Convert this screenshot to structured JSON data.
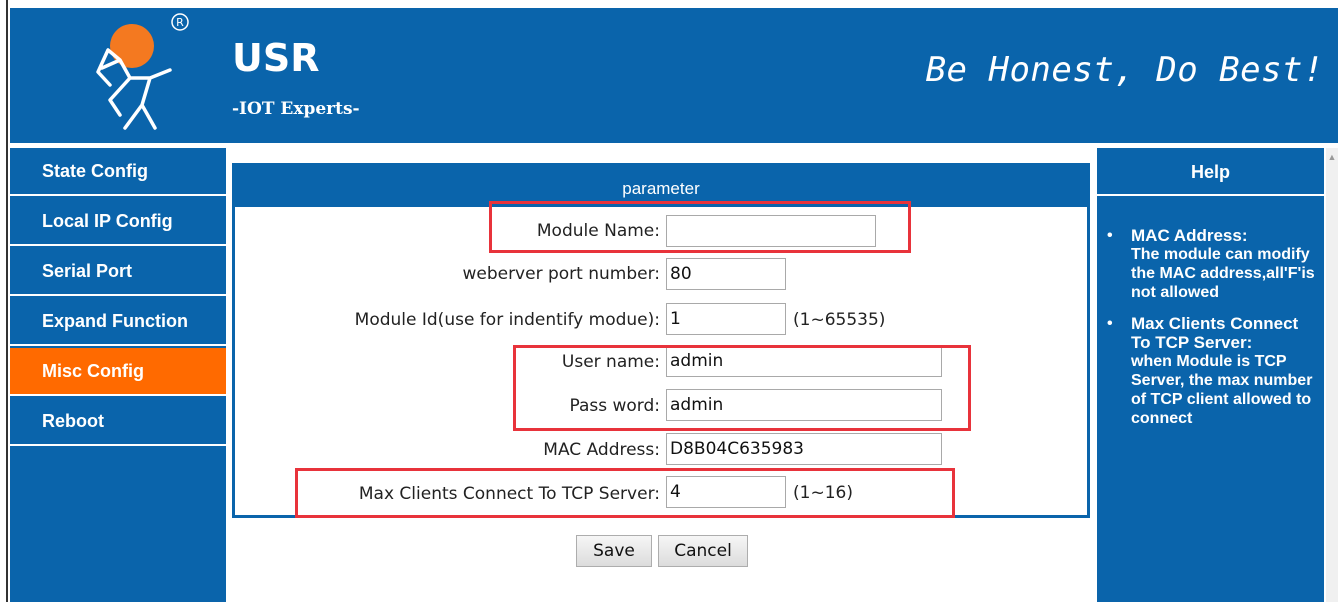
{
  "header": {
    "brand": "USR",
    "tagline": "-IOT Experts-",
    "motto": "Be Honest, Do Best!",
    "colors": {
      "brand_blue": "#0a64ab",
      "logo_orange": "#f47920",
      "accent_orange": "#ff6a00",
      "highlight_red": "#e8333b"
    }
  },
  "sidebar": {
    "items": [
      {
        "label": "State Config",
        "active": false
      },
      {
        "label": "Local IP Config",
        "active": false
      },
      {
        "label": "Serial Port",
        "active": false
      },
      {
        "label": "Expand Function",
        "active": false
      },
      {
        "label": "Misc Config",
        "active": true
      },
      {
        "label": "Reboot",
        "active": false
      }
    ]
  },
  "panel": {
    "title": "parameter",
    "fields": {
      "module_name": {
        "label": "Module Name:",
        "value": ""
      },
      "webserver_port": {
        "label": "weberver port number:",
        "value": "80"
      },
      "module_id": {
        "label": "Module Id(use for indentify modue):",
        "value": "1",
        "range": "(1~65535)"
      },
      "user_name": {
        "label": "User name:",
        "value": "admin"
      },
      "password": {
        "label": "Pass word:",
        "value": "admin"
      },
      "mac_address": {
        "label": "MAC Address:",
        "value": "D8B04C635983"
      },
      "max_clients": {
        "label": "Max Clients Connect To TCP Server:",
        "value": "4",
        "range": "(1~16)"
      }
    },
    "buttons": {
      "save": "Save",
      "cancel": "Cancel"
    }
  },
  "help": {
    "title": "Help",
    "items": [
      {
        "heading": "MAC Address:",
        "body": "The module can modify the MAC address,all'F'is not allowed"
      },
      {
        "heading": "Max Clients Connect To TCP Server:",
        "body": "when Module is TCP Server, the max number of TCP client allowed to connect"
      }
    ]
  }
}
